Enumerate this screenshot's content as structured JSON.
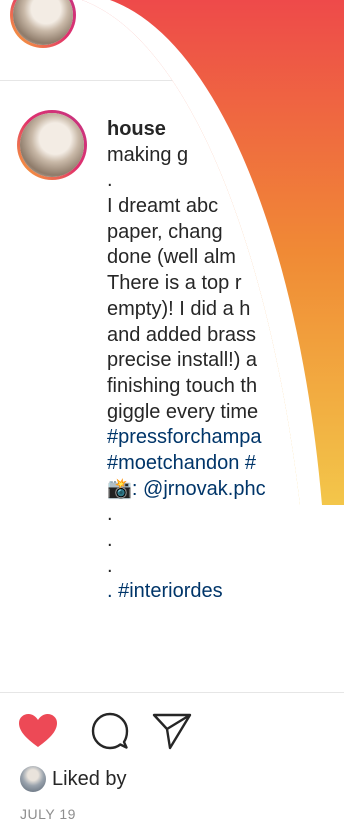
{
  "post": {
    "username": "house",
    "caption_lines": [
      "making g",
      ".",
      "I dreamt abc",
      "paper, chang",
      "done (well alm",
      "There is a top r",
      "empty)! I did a h",
      "and added brass",
      "precise install!) a",
      "finishing touch th",
      "giggle every time",
      "#pressforchampa",
      "#moetchandon #",
      "📸: @jrnovak.phc",
      ".",
      ".",
      ".",
      ". #interiordes"
    ]
  },
  "actions": {
    "like_icon": "heart-filled-icon",
    "comment_icon": "comment-bubble-icon",
    "share_icon": "paper-plane-icon"
  },
  "liked_by": {
    "text": "Liked by"
  },
  "date": "JULY 19",
  "colors": {
    "like_red": "#ed4956",
    "hashtag_blue": "#003569",
    "gradient_top": "#ee4a4a",
    "gradient_bottom": "#f3c64a"
  }
}
